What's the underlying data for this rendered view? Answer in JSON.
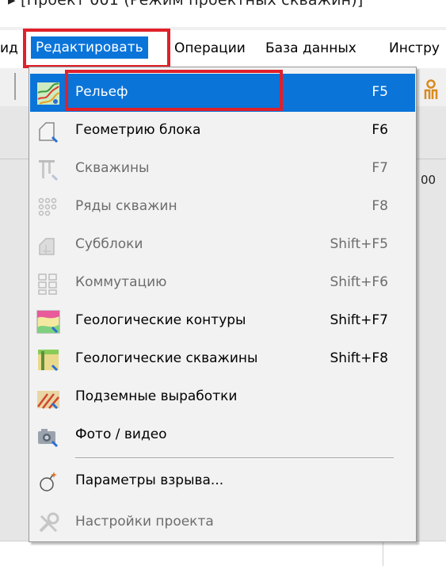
{
  "window": {
    "title": "▸ [Проект 001 (Режим проектных скважин)]"
  },
  "menubar": {
    "partial_left": "ид",
    "items": [
      "Редактировать",
      "Операции",
      "База данных",
      "Инстру"
    ]
  },
  "background": {
    "axis_value": "00"
  },
  "dropdown": {
    "items": [
      {
        "label": "Рельеф",
        "shortcut": "F5",
        "state": "highlighted",
        "icon": "relief-icon"
      },
      {
        "label": "Геометрию блока",
        "shortcut": "F6",
        "state": "enabled",
        "icon": "block-geometry-icon"
      },
      {
        "label": "Скважины",
        "shortcut": "F7",
        "state": "disabled",
        "icon": "wells-icon"
      },
      {
        "label": "Ряды скважин",
        "shortcut": "F8",
        "state": "disabled",
        "icon": "well-rows-icon"
      },
      {
        "label": "Субблоки",
        "shortcut": "Shift+F5",
        "state": "disabled",
        "icon": "subblocks-icon"
      },
      {
        "label": "Коммутацию",
        "shortcut": "Shift+F6",
        "state": "disabled",
        "icon": "commutation-icon"
      },
      {
        "label": "Геологические контуры",
        "shortcut": "Shift+F7",
        "state": "enabled",
        "icon": "geological-contours-icon"
      },
      {
        "label": "Геологические скважины",
        "shortcut": "Shift+F8",
        "state": "enabled",
        "icon": "geological-wells-icon"
      },
      {
        "label": "Подземные выработки",
        "shortcut": "",
        "state": "enabled",
        "icon": "underground-workings-icon"
      },
      {
        "label": "Фото / видео",
        "shortcut": "",
        "state": "enabled",
        "icon": "camera-icon"
      },
      {
        "label": "Параметры взрыва...",
        "shortcut": "",
        "state": "enabled",
        "icon": "explosion-params-icon"
      },
      {
        "label": "Настройки проекта",
        "shortcut": "",
        "state": "disabled",
        "icon": "project-settings-icon"
      }
    ]
  },
  "colors": {
    "highlight": "#0a74d9",
    "annotation": "#e0202a",
    "disabled_text": "#6d6d6d"
  }
}
